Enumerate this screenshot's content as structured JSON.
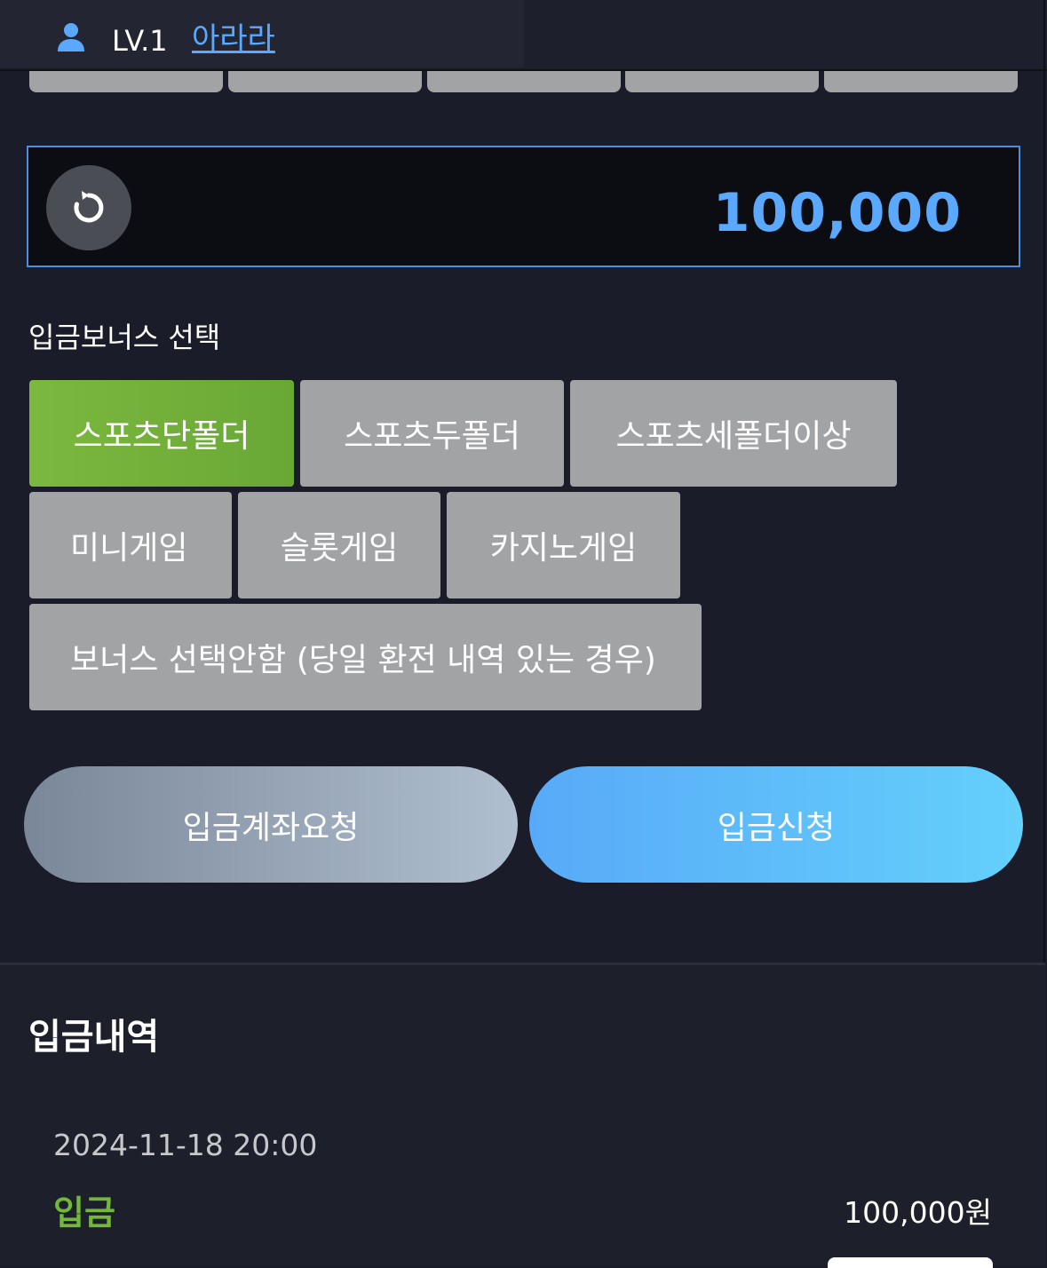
{
  "header": {
    "level": "LV.1",
    "username": "아라라"
  },
  "deposit": {
    "amount": "100,000"
  },
  "bonus": {
    "label": "입금보너스 선택",
    "options": [
      {
        "label": "스포츠단폴더",
        "selected": true
      },
      {
        "label": "스포츠두폴더",
        "selected": false
      },
      {
        "label": "스포츠세폴더이상",
        "selected": false
      },
      {
        "label": "미니게임",
        "selected": false
      },
      {
        "label": "슬롯게임",
        "selected": false
      },
      {
        "label": "카지노게임",
        "selected": false
      },
      {
        "label": "보너스 선택안함 (당일 환전 내역 있는 경우)",
        "selected": false
      }
    ]
  },
  "actions": {
    "request_account": "입금계좌요청",
    "apply_deposit": "입금신청"
  },
  "history": {
    "title": "입금내역",
    "entries": [
      {
        "date": "2024-11-18 20:00",
        "type": "입금",
        "amount": "100,000원"
      }
    ]
  },
  "colors": {
    "accent_blue": "#5aa9ff",
    "selected_green": "#72b83a",
    "background": "#1a1c2a"
  }
}
